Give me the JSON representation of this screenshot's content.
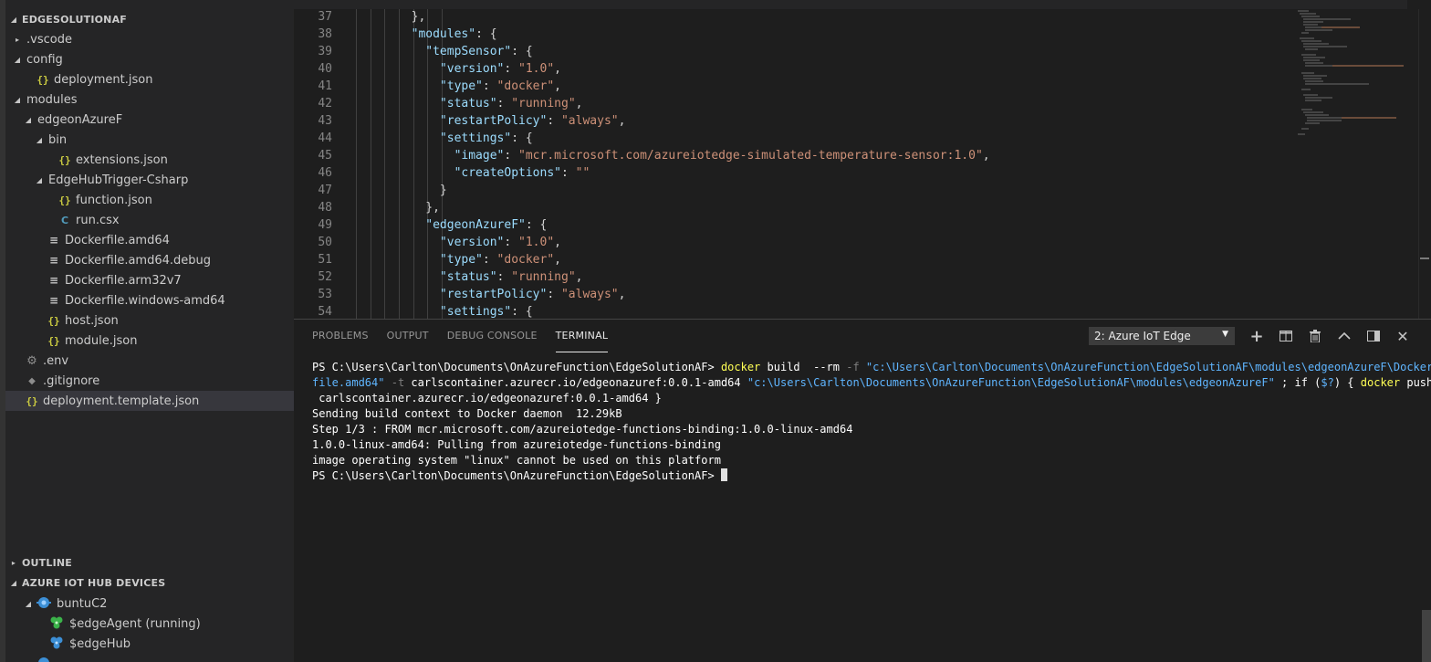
{
  "explorer": {
    "title": "EDGESOLUTIONAF",
    "items": [
      {
        "label": ".vscode",
        "kind": "folder",
        "expanded": false,
        "depth": 1
      },
      {
        "label": "config",
        "kind": "folder",
        "expanded": true,
        "depth": 1
      },
      {
        "label": "deployment.json",
        "kind": "json",
        "depth": 2
      },
      {
        "label": "modules",
        "kind": "folder",
        "expanded": true,
        "depth": 1
      },
      {
        "label": "edgeonAzureF",
        "kind": "folder",
        "expanded": true,
        "depth": 2
      },
      {
        "label": "bin",
        "kind": "folder",
        "expanded": true,
        "depth": 3
      },
      {
        "label": "extensions.json",
        "kind": "json",
        "depth": 4
      },
      {
        "label": "EdgeHubTrigger-Csharp",
        "kind": "folder",
        "expanded": true,
        "depth": 3
      },
      {
        "label": "function.json",
        "kind": "json",
        "depth": 4
      },
      {
        "label": "run.csx",
        "kind": "csx",
        "depth": 4
      },
      {
        "label": "Dockerfile.amd64",
        "kind": "docker",
        "depth": 3
      },
      {
        "label": "Dockerfile.amd64.debug",
        "kind": "docker",
        "depth": 3
      },
      {
        "label": "Dockerfile.arm32v7",
        "kind": "docker",
        "depth": 3
      },
      {
        "label": "Dockerfile.windows-amd64",
        "kind": "docker",
        "depth": 3
      },
      {
        "label": "host.json",
        "kind": "json",
        "depth": 3
      },
      {
        "label": "module.json",
        "kind": "json",
        "depth": 3
      },
      {
        "label": ".env",
        "kind": "gear",
        "depth": 1
      },
      {
        "label": ".gitignore",
        "kind": "diamond",
        "depth": 1
      },
      {
        "label": "deployment.template.json",
        "kind": "json",
        "depth": 1,
        "selected": true
      }
    ]
  },
  "outline": {
    "title": "OUTLINE"
  },
  "iot_hub": {
    "title": "AZURE IOT HUB DEVICES",
    "device": "buntuC2",
    "modules": [
      "$edgeAgent (running)",
      "$edgeHub"
    ]
  },
  "editor": {
    "lines": [
      {
        "n": "37",
        "indent": 4,
        "parts": [
          [
            "p",
            "},"
          ]
        ]
      },
      {
        "n": "38",
        "indent": 4,
        "parts": [
          [
            "k",
            "\"modules\""
          ],
          [
            "p",
            ": {"
          ]
        ]
      },
      {
        "n": "39",
        "indent": 5,
        "parts": [
          [
            "k",
            "\"tempSensor\""
          ],
          [
            "p",
            ": {"
          ]
        ]
      },
      {
        "n": "40",
        "indent": 6,
        "parts": [
          [
            "k",
            "\"version\""
          ],
          [
            "p",
            ": "
          ],
          [
            "s",
            "\"1.0\""
          ],
          [
            "p",
            ","
          ]
        ]
      },
      {
        "n": "41",
        "indent": 6,
        "parts": [
          [
            "k",
            "\"type\""
          ],
          [
            "p",
            ": "
          ],
          [
            "s",
            "\"docker\""
          ],
          [
            "p",
            ","
          ]
        ]
      },
      {
        "n": "42",
        "indent": 6,
        "parts": [
          [
            "k",
            "\"status\""
          ],
          [
            "p",
            ": "
          ],
          [
            "s",
            "\"running\""
          ],
          [
            "p",
            ","
          ]
        ]
      },
      {
        "n": "43",
        "indent": 6,
        "parts": [
          [
            "k",
            "\"restartPolicy\""
          ],
          [
            "p",
            ": "
          ],
          [
            "s",
            "\"always\""
          ],
          [
            "p",
            ","
          ]
        ]
      },
      {
        "n": "44",
        "indent": 6,
        "parts": [
          [
            "k",
            "\"settings\""
          ],
          [
            "p",
            ": {"
          ]
        ]
      },
      {
        "n": "45",
        "indent": 7,
        "parts": [
          [
            "k",
            "\"image\""
          ],
          [
            "p",
            ": "
          ],
          [
            "s",
            "\"mcr.microsoft.com/azureiotedge-simulated-temperature-sensor:1.0\""
          ],
          [
            "p",
            ","
          ]
        ]
      },
      {
        "n": "46",
        "indent": 7,
        "parts": [
          [
            "k",
            "\"createOptions\""
          ],
          [
            "p",
            ": "
          ],
          [
            "s",
            "\"\""
          ]
        ]
      },
      {
        "n": "47",
        "indent": 6,
        "parts": [
          [
            "p",
            "}"
          ]
        ]
      },
      {
        "n": "48",
        "indent": 5,
        "parts": [
          [
            "p",
            "},"
          ]
        ]
      },
      {
        "n": "49",
        "indent": 5,
        "parts": [
          [
            "k",
            "\"edgeonAzureF\""
          ],
          [
            "p",
            ": {"
          ]
        ]
      },
      {
        "n": "50",
        "indent": 6,
        "parts": [
          [
            "k",
            "\"version\""
          ],
          [
            "p",
            ": "
          ],
          [
            "s",
            "\"1.0\""
          ],
          [
            "p",
            ","
          ]
        ]
      },
      {
        "n": "51",
        "indent": 6,
        "parts": [
          [
            "k",
            "\"type\""
          ],
          [
            "p",
            ": "
          ],
          [
            "s",
            "\"docker\""
          ],
          [
            "p",
            ","
          ]
        ]
      },
      {
        "n": "52",
        "indent": 6,
        "parts": [
          [
            "k",
            "\"status\""
          ],
          [
            "p",
            ": "
          ],
          [
            "s",
            "\"running\""
          ],
          [
            "p",
            ","
          ]
        ]
      },
      {
        "n": "53",
        "indent": 6,
        "parts": [
          [
            "k",
            "\"restartPolicy\""
          ],
          [
            "p",
            ": "
          ],
          [
            "s",
            "\"always\""
          ],
          [
            "p",
            ","
          ]
        ]
      },
      {
        "n": "54",
        "indent": 6,
        "parts": [
          [
            "k",
            "\"settings\""
          ],
          [
            "p",
            ": {"
          ]
        ]
      }
    ]
  },
  "panel": {
    "tabs": [
      "PROBLEMS",
      "OUTPUT",
      "DEBUG CONSOLE",
      "TERMINAL"
    ],
    "active_tab": "TERMINAL",
    "terminal_select": "2: Azure IoT Edge",
    "terminal_lines": [
      [
        [
          "b",
          "PS C:\\Users\\Carlton\\Documents\\OnAzureFunction\\EdgeSolutionAF> "
        ],
        [
          "y",
          "docker"
        ],
        [
          "b",
          " build  --rm "
        ],
        [
          "g",
          "-f"
        ],
        [
          "b",
          " "
        ],
        [
          "c",
          "\"c:\\Users\\Carlton\\Documents\\OnAzureFunction\\EdgeSolutionAF\\modules\\edgeonAzureF\\Docker"
        ]
      ],
      [
        [
          "c",
          "file.amd64\""
        ],
        [
          "b",
          " "
        ],
        [
          "g",
          "-t"
        ],
        [
          "b",
          " carlscontainer.azurecr.io/edgeonazuref:0.0.1-amd64 "
        ],
        [
          "c",
          "\"c:\\Users\\Carlton\\Documents\\OnAzureFunction\\EdgeSolutionAF\\modules\\edgeonAzureF\""
        ],
        [
          "b",
          " ; if ("
        ],
        [
          "c",
          "$?"
        ],
        [
          "b",
          ") { "
        ],
        [
          "y",
          "docker"
        ],
        [
          "b",
          " push"
        ]
      ],
      [
        [
          "b",
          " carlscontainer.azurecr.io/edgeonazuref:0.0.1-amd64 }"
        ]
      ],
      [
        [
          "b",
          "Sending build context to Docker daemon  12.29kB"
        ]
      ],
      [
        [
          "b",
          "Step 1/3 : FROM mcr.microsoft.com/azureiotedge-functions-binding:1.0.0-linux-amd64"
        ]
      ],
      [
        [
          "b",
          "1.0.0-linux-amd64: Pulling from azureiotedge-functions-binding"
        ]
      ],
      [
        [
          "b",
          "image operating system \"linux\" cannot be used on this platform"
        ]
      ],
      [
        [
          "b",
          "PS C:\\Users\\Carlton\\Documents\\OnAzureFunction\\EdgeSolutionAF> "
        ]
      ]
    ]
  },
  "colors": {
    "json_icon": "#cbcb41",
    "csx_icon": "#519aba",
    "json_key": "#9cdcfe",
    "json_string": "#ce9178",
    "terminal_command": "#ffff55",
    "terminal_string": "#5fb5ff",
    "device_icon": "#3c8fd6",
    "module_running": "#3bb34a"
  }
}
